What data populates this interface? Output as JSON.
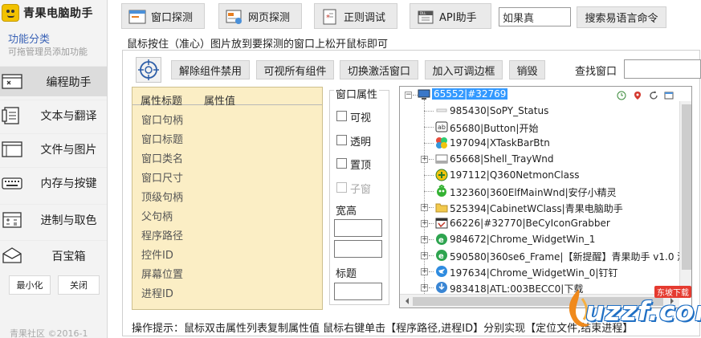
{
  "app": {
    "title": "青果电脑助手"
  },
  "sidebar": {
    "category_title": "功能分类",
    "category_hint": "可拖管理员添加功能",
    "items": [
      {
        "label": "编程助手",
        "icon": "window-x-icon",
        "selected": true
      },
      {
        "label": "文本与翻译",
        "icon": "document-icon",
        "selected": false
      },
      {
        "label": "文件与图片",
        "icon": "folder-window-icon",
        "selected": false
      },
      {
        "label": "内存与按键",
        "icon": "keyboard-icon",
        "selected": false
      },
      {
        "label": "进制与取色",
        "icon": "calculator-icon",
        "selected": false
      },
      {
        "label": "百宝箱",
        "icon": "treasure-box-icon",
        "selected": false
      }
    ],
    "minimize_label": "最小化",
    "close_label": "关闭",
    "copyright": "青果社区 ©2016-1"
  },
  "toolbar": {
    "buttons": [
      {
        "label": "窗口探测",
        "icon": "window-probe-icon"
      },
      {
        "label": "网页探测",
        "icon": "web-probe-icon"
      },
      {
        "label": "正则调试",
        "icon": "regex-debug-icon"
      },
      {
        "label": "API助手",
        "icon": "api-dll-icon"
      }
    ],
    "search_value": "如果真",
    "search_button": "搜索易语言命令"
  },
  "main": {
    "instruction": "鼠标按住（准心）图片放到要探测的窗口上松开鼠标即可",
    "actions": [
      "解除组件禁用",
      "可视所有组件",
      "切换激活窗口",
      "加入可调边框",
      "销毁"
    ],
    "find_label": "查找窗口",
    "find_value": "",
    "property_table": {
      "headers": [
        "属性标题",
        "属性值"
      ],
      "rows": [
        "窗口句柄",
        "窗口标题",
        "窗口类名",
        "窗口尺寸",
        "顶级句柄",
        "父句柄",
        "程序路径",
        "控件ID",
        "屏幕位置",
        "进程ID"
      ]
    },
    "window_attributes": {
      "title": "窗口属性",
      "checkboxes": [
        {
          "label": "可视",
          "checked": false,
          "enabled": true
        },
        {
          "label": "透明",
          "checked": false,
          "enabled": true
        },
        {
          "label": "置顶",
          "checked": false,
          "enabled": true
        },
        {
          "label": "子窗",
          "checked": false,
          "enabled": false
        }
      ],
      "width_height_label": "宽高",
      "title_label": "标题"
    },
    "tree": {
      "root": "65552|#32769",
      "nodes": [
        {
          "label": "985430|SoPY_Status",
          "icon": "blank-window-icon",
          "expandable": false
        },
        {
          "label": "65680|Button|开始",
          "icon": "ab-button-icon",
          "expandable": false
        },
        {
          "label": "197094|XTaskBarBtn",
          "icon": "colorful-app-icon",
          "expandable": false
        },
        {
          "label": "65668|Shell_TrayWnd",
          "icon": "tray-window-icon",
          "expandable": true
        },
        {
          "label": "197112|Q360NetmonClass",
          "icon": "netmon-plus-icon",
          "expandable": false
        },
        {
          "label": "132360|360ElfMainWnd|安仔小精灵",
          "icon": "green-elf-icon",
          "expandable": false
        },
        {
          "label": "525394|CabinetWClass|青果电脑助手",
          "icon": "folder-icon",
          "expandable": true
        },
        {
          "label": "66226|#32770|BeCyIconGrabber",
          "icon": "icon-grabber-icon",
          "expandable": true
        },
        {
          "label": "984672|Chrome_WidgetWin_1",
          "icon": "browser-e-icon",
          "expandable": true
        },
        {
          "label": "590580|360se6_Frame|【新提醒】青果助手 v1.0 测",
          "icon": "browser-e-icon",
          "expandable": true
        },
        {
          "label": "197634|Chrome_WidgetWin_0|钉钉",
          "icon": "dingtalk-icon",
          "expandable": true
        },
        {
          "label": "983418|ATL:003BECC0|下载",
          "icon": "download-icon",
          "expandable": true
        }
      ]
    },
    "hint": "操作提示：鼠标双击属性列表复制属性值  鼠标右键单击【程序路径,进程ID】分别实现【定位文件,结束进程】"
  },
  "watermark": {
    "text": "uzzf.com",
    "badge": "东坡下载"
  },
  "colors": {
    "property_bg": "#fbeec5",
    "selection": "#3399ff",
    "sidebar_bg": "#f3f3f3",
    "accent_text": "#3b63b6"
  }
}
